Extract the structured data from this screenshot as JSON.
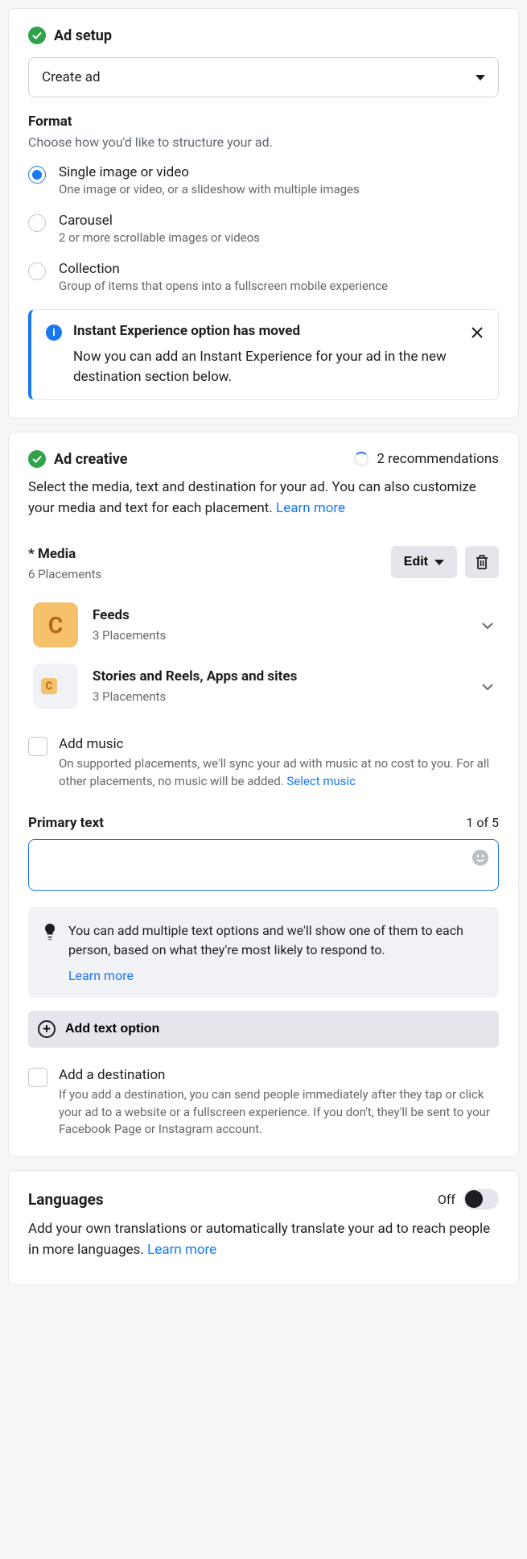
{
  "ad_setup": {
    "title": "Ad setup",
    "dropdown_value": "Create ad",
    "format_label": "Format",
    "format_desc": "Choose how you'd like to structure your ad.",
    "options": [
      {
        "title": "Single image or video",
        "desc": "One image or video, or a slideshow with multiple images",
        "selected": true
      },
      {
        "title": "Carousel",
        "desc": "2 or more scrollable images or videos",
        "selected": false
      },
      {
        "title": "Collection",
        "desc": "Group of items that opens into a fullscreen mobile experience",
        "selected": false
      }
    ],
    "notice": {
      "title": "Instant Experience option has moved",
      "body": "Now you can add an Instant Experience for your ad in the new destination section below."
    }
  },
  "ad_creative": {
    "title": "Ad creative",
    "recommendations": "2 recommendations",
    "desc": "Select the media, text and destination for your ad. You can also customize your media and text for each placement.",
    "learn_more": "Learn more",
    "media": {
      "label": "* Media",
      "placements": "6 Placements",
      "edit_label": "Edit",
      "items": [
        {
          "title": "Feeds",
          "sub": "3 Placements",
          "letter": "C",
          "big": true
        },
        {
          "title": "Stories and Reels, Apps and sites",
          "sub": "3 Placements",
          "letter": "C",
          "big": false
        }
      ]
    },
    "add_music": {
      "label": "Add music",
      "desc": "On supported placements, we'll sync your ad with music at no cost to you. For all other placements, no music will be added.",
      "link": "Select music"
    },
    "primary_text": {
      "label": "Primary text",
      "counter": "1 of 5",
      "value": "",
      "tip": "You can add multiple text options and we'll show one of them to each person, based on what they're most likely to respond to.",
      "tip_link": "Learn more",
      "add_option": "Add text option"
    },
    "add_destination": {
      "label": "Add a destination",
      "desc": "If you add a destination, you can send people immediately after they tap or click your ad to a website or a fullscreen experience. If you don't, they'll be sent to your Facebook Page or Instagram account."
    }
  },
  "languages": {
    "title": "Languages",
    "toggle_label": "Off",
    "desc": "Add your own translations or automatically translate your ad to reach people in more languages.",
    "learn_more": "Learn more"
  }
}
